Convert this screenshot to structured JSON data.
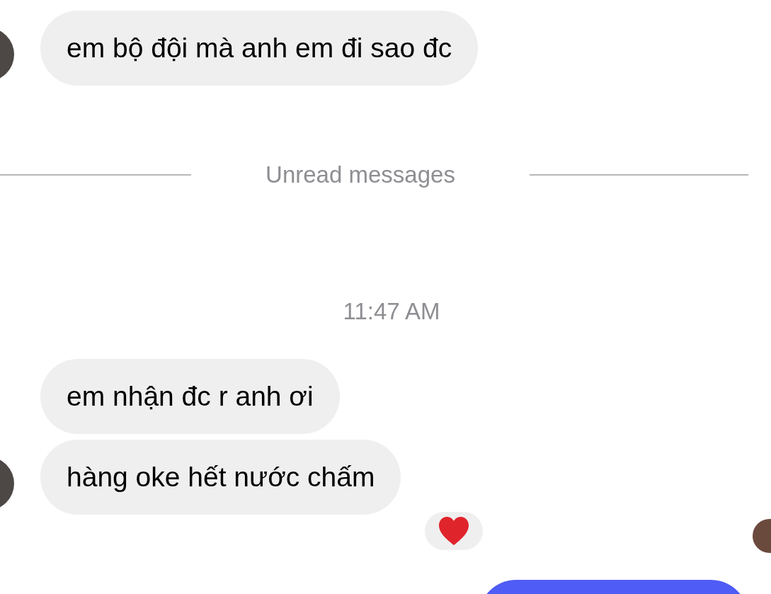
{
  "items": [
    {
      "kind": "message",
      "text": "em bộ đội mà anh em đi sao đc",
      "avatar": true
    },
    {
      "kind": "divider",
      "text": "Unread messages"
    },
    {
      "kind": "time",
      "text": "11:47 AM"
    },
    {
      "kind": "message",
      "text": "em nhận đc r anh ơi",
      "avatar": false
    },
    {
      "kind": "message",
      "text": "hàng oke hết nước chấm",
      "avatar": true,
      "reacted": true,
      "read_receipt": true
    },
    {
      "kind": "outgoing"
    }
  ]
}
